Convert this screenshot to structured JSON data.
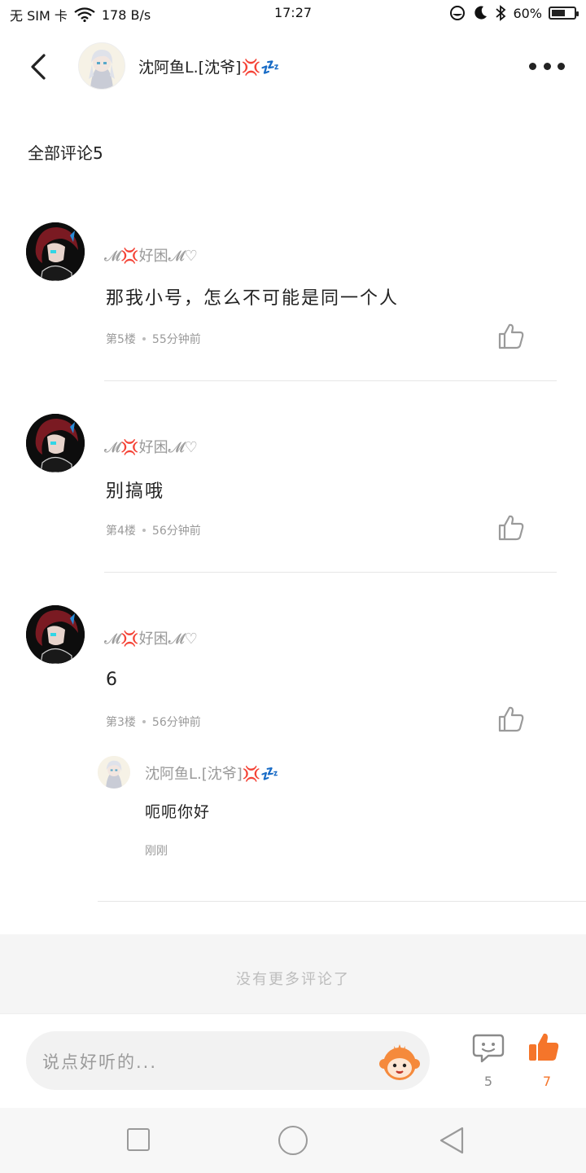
{
  "status_bar": {
    "carrier": "无 SIM 卡",
    "speed": "178 B/s",
    "time": "17:27",
    "battery": "60%",
    "battery_level": 0.6
  },
  "header": {
    "username": "沈阿鱼L.[沈爷]💢💤"
  },
  "section": {
    "title": "全部评论5"
  },
  "comments": [
    {
      "username": "𝓜💢好困𝓜♡",
      "text": "那我小号，怎么不可能是同一个人",
      "floor": "第5楼",
      "time": "55分钟前"
    },
    {
      "username": "𝓜💢好困𝓜♡",
      "text": "别搞哦",
      "floor": "第4楼",
      "time": "56分钟前"
    },
    {
      "username": "𝓜💢好困𝓜♡",
      "text": "6",
      "floor": "第3楼",
      "time": "56分钟前"
    }
  ],
  "reply": {
    "username": "沈阿鱼L.[沈爷]💢💤",
    "text": "呃呃你好",
    "time": "刚刚"
  },
  "footer": {
    "end_text": "没有更多评论了"
  },
  "input": {
    "placeholder": "说点好听的...",
    "comment_count": "5",
    "like_count": "7"
  },
  "colors": {
    "accent": "#f5752a",
    "muted": "#9a9a9a"
  }
}
